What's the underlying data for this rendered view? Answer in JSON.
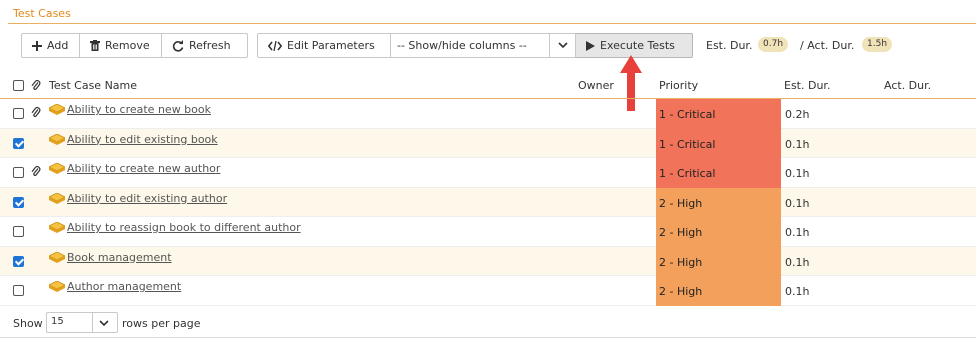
{
  "section": {
    "title": "Test Cases"
  },
  "toolbar": {
    "add_label": "Add",
    "remove_label": "Remove",
    "refresh_label": "Refresh",
    "edit_parameters_label": "Edit Parameters",
    "columns_select_value": "-- Show/hide columns --",
    "execute_label": "Execute Tests",
    "est_dur_label": "Est. Dur.",
    "est_dur_value": "0.7h",
    "act_dur_label": "/ Act. Dur.",
    "act_dur_value": "1.5h"
  },
  "table": {
    "headers": {
      "name": "Test Case Name",
      "owner": "Owner",
      "priority": "Priority",
      "est": "Est. Dur.",
      "act": "Act. Dur."
    },
    "rows": [
      {
        "name": "Ability to create new book",
        "priority": "1 - Critical",
        "est": "0.2h",
        "checked": false,
        "attachment": true
      },
      {
        "name": "Ability to edit existing book",
        "priority": "1 - Critical",
        "est": "0.1h",
        "checked": true,
        "attachment": false
      },
      {
        "name": "Ability to create new author",
        "priority": "1 - Critical",
        "est": "0.1h",
        "checked": false,
        "attachment": true
      },
      {
        "name": "Ability to edit existing author",
        "priority": "2 - High",
        "est": "0.1h",
        "checked": true,
        "attachment": false
      },
      {
        "name": "Ability to reassign book to different author",
        "priority": "2 - High",
        "est": "0.1h",
        "checked": false,
        "attachment": false
      },
      {
        "name": "Book management",
        "priority": "2 - High",
        "est": "0.1h",
        "checked": true,
        "attachment": false
      },
      {
        "name": "Author management",
        "priority": "2 - High",
        "est": "0.1h",
        "checked": false,
        "attachment": false
      }
    ]
  },
  "pagination": {
    "show_label": "Show",
    "page_size": "15",
    "rows_per_page_label": "rows per page"
  },
  "colors": {
    "critical": "#f0735a",
    "high": "#f2a05c",
    "accent": "#e08a1e",
    "selected_row": "#fdf8e9",
    "arrow": "#e8403a"
  },
  "icons": {
    "add": "plus-icon",
    "remove": "trash-icon",
    "refresh": "refresh-icon",
    "edit_parameters": "code-icon",
    "execute": "play-icon",
    "attachment": "paperclip-icon",
    "test_case": "test-case-icon"
  }
}
